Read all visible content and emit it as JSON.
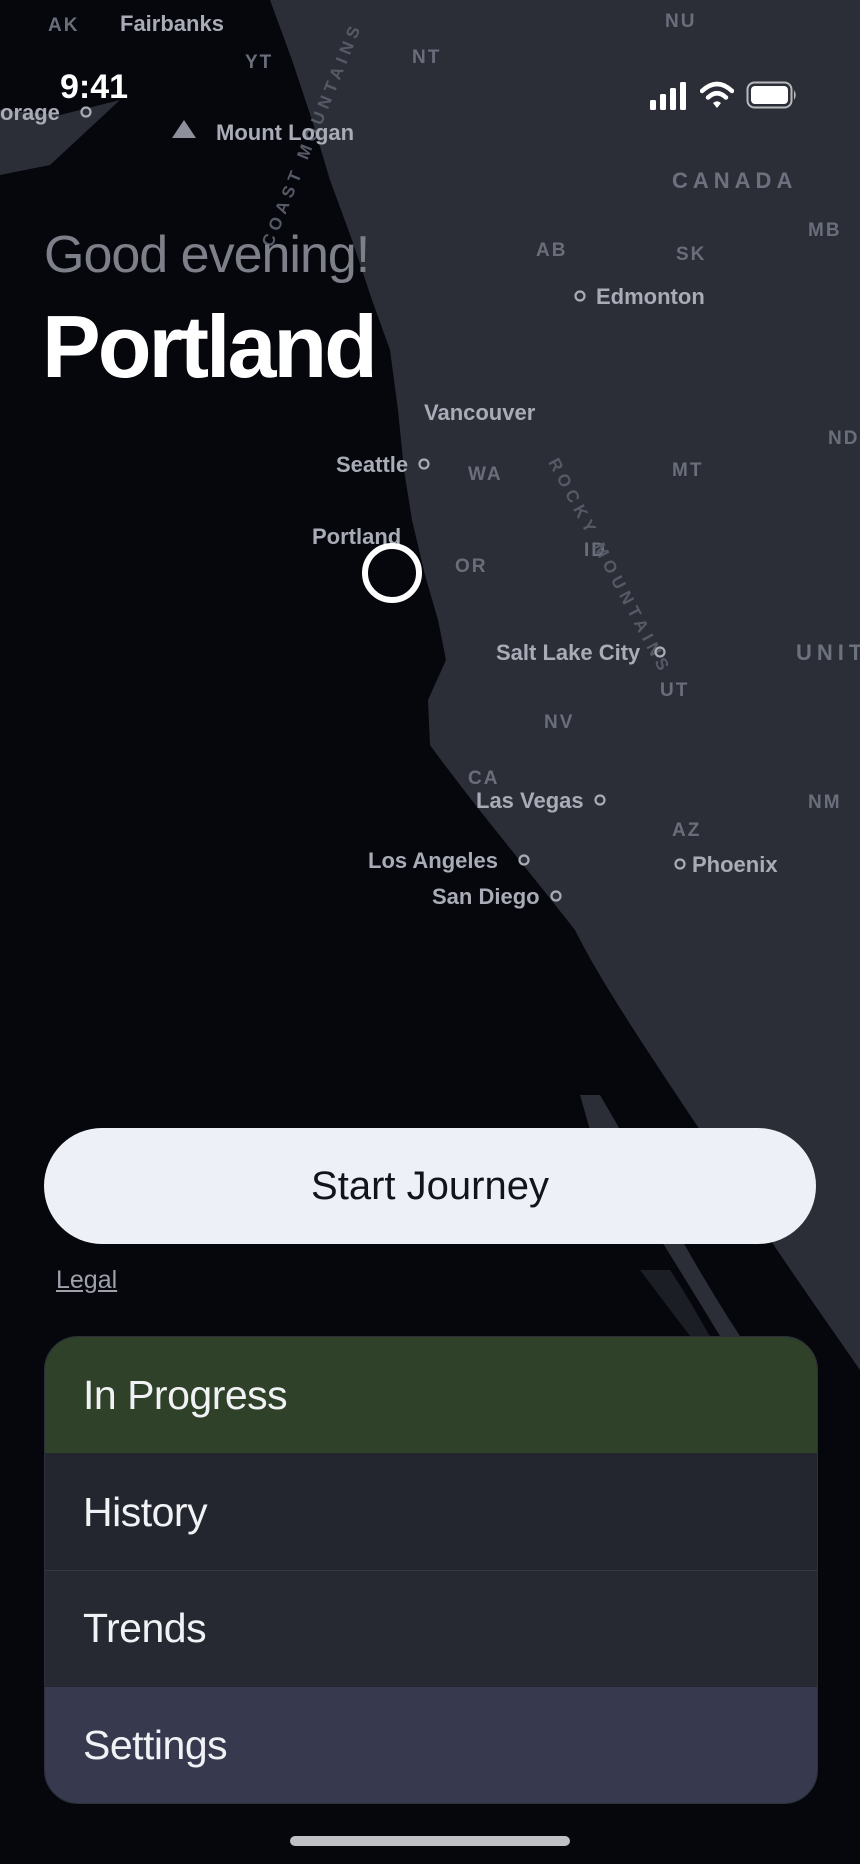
{
  "status_bar": {
    "time": "9:41",
    "icons": [
      "cellular-signal-icon",
      "wifi-icon",
      "battery-icon"
    ]
  },
  "header": {
    "greeting": "Good evening!",
    "city": "Portland"
  },
  "map": {
    "country_labels": [
      "CANADA",
      "UNIT"
    ],
    "region_labels": [
      "AK",
      "YT",
      "NT",
      "NU",
      "AB",
      "SK",
      "MB",
      "ND",
      "WA",
      "MT",
      "OR",
      "ID",
      "UT",
      "NV",
      "CA",
      "AZ",
      "NM"
    ],
    "cities": [
      "Fairbanks",
      "orage",
      "Mount Logan",
      "Edmonton",
      "Vancouver",
      "Seattle",
      "Portland",
      "Salt Lake City",
      "Las Vegas",
      "Los Angeles",
      "San Diego",
      "Phoenix"
    ],
    "mountain_labels": [
      "COAST MOUNTAINS",
      "ROCKY MOUNTAINS"
    ]
  },
  "actions": {
    "start_label": "Start Journey",
    "legal_label": "Legal"
  },
  "menu": {
    "items": [
      "In Progress",
      "History",
      "Trends",
      "Settings"
    ]
  },
  "colors": {
    "background": "#05070d",
    "land": "#2b2e37",
    "in_progress": "#2f4128",
    "settings": "#373a4e",
    "button": "#eef0f8"
  }
}
